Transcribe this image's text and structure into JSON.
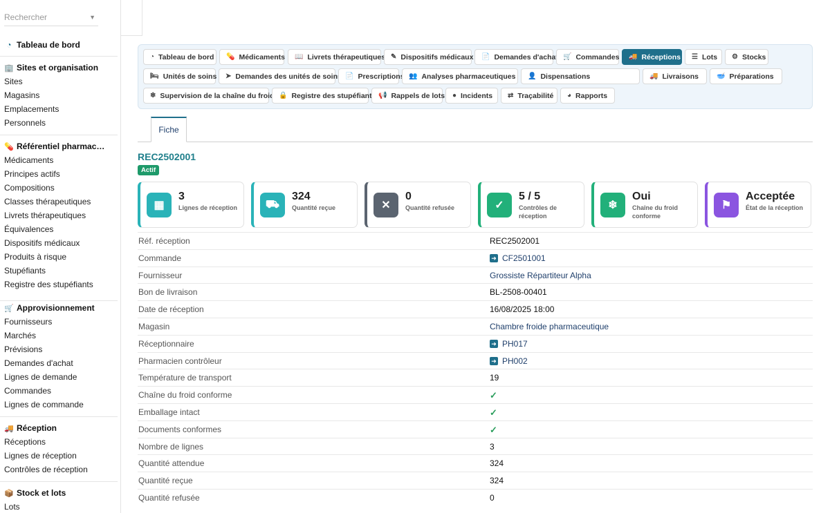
{
  "sidebar": {
    "search_placeholder": "Rechercher",
    "dashboard": "Tableau de bord",
    "sections": [
      {
        "title": "Sites et organisation",
        "items": [
          "Sites",
          "Magasins",
          "Emplacements",
          "Personnels"
        ]
      },
      {
        "title": "Référentiel pharmac…",
        "items": [
          "Médicaments",
          "Principes actifs",
          "Compositions",
          "Classes thérapeutiques",
          "Livrets thérapeutiques",
          "Équivalences",
          "Dispositifs médicaux",
          "Produits à risque",
          "Stupéfiants",
          "Registre des stupéfiants"
        ]
      },
      {
        "title": "Approvisionnement",
        "items": [
          "Fournisseurs",
          "Marchés",
          "Prévisions",
          "Demandes d'achat",
          "Lignes de demande",
          "Commandes",
          "Lignes de commande"
        ]
      },
      {
        "title": "Réception",
        "items": [
          "Réceptions",
          "Lignes de réception",
          "Contrôles de réception"
        ]
      },
      {
        "title": "Stock et lots",
        "items": [
          "Lots"
        ]
      }
    ]
  },
  "nav": {
    "row1": [
      "Tableau de bord",
      "Médicaments",
      "Livrets thérapeutiques",
      "Dispositifs médicaux",
      "Demandes d'achat",
      "Commandes",
      "Réceptions",
      "Lots",
      "Stocks"
    ],
    "row2": [
      "Unités de soins",
      "Demandes des unités de soins",
      "Prescriptions",
      "Analyses pharmaceutiques",
      "Dispensations",
      "Livraisons",
      "Préparations"
    ],
    "row3": [
      "Supervision de la chaîne du froid",
      "Registre des stupéfiants",
      "Rappels de lots",
      "Incidents",
      "Traçabilité",
      "Rapports"
    ],
    "active": "Réceptions"
  },
  "tab": "Fiche",
  "record": {
    "title": "REC2502001",
    "status": "Actif"
  },
  "cards": [
    {
      "value": "3",
      "label": "Lignes de réception",
      "color": "#2ab3b8"
    },
    {
      "value": "324",
      "label": "Quantité reçue",
      "color": "#2ab3b8"
    },
    {
      "value": "0",
      "label": "Quantité refusée",
      "color": "#5b6470"
    },
    {
      "value": "5 / 5",
      "label": "Contrôles de réception",
      "color": "#22b07a"
    },
    {
      "value": "Oui",
      "label": "Chaîne du froid conforme",
      "color": "#22b07a"
    },
    {
      "value": "Acceptée",
      "label": "État de la réception",
      "color": "#8b55e0"
    }
  ],
  "fields": [
    {
      "label": "Réf. réception",
      "value": "REC2502001"
    },
    {
      "label": "Commande",
      "value": "CF2501001",
      "link": true,
      "icon": true
    },
    {
      "label": "Fournisseur",
      "value": "Grossiste Répartiteur Alpha",
      "link": true
    },
    {
      "label": "Bon de livraison",
      "value": "BL-2508-00401"
    },
    {
      "label": "Date de réception",
      "value": "16/08/2025 18:00"
    },
    {
      "label": "Magasin",
      "value": "Chambre froide pharmaceutique",
      "link": true
    },
    {
      "label": "Réceptionnaire",
      "value": "PH017",
      "link": true,
      "icon": true
    },
    {
      "label": "Pharmacien contrôleur",
      "value": "PH002",
      "link": true,
      "icon": true
    },
    {
      "label": "Température de transport",
      "value": "19"
    },
    {
      "label": "Chaîne du froid conforme",
      "check": true
    },
    {
      "label": "Emballage intact",
      "check": true
    },
    {
      "label": "Documents conformes",
      "check": true
    },
    {
      "label": "Nombre de lignes",
      "value": "3"
    },
    {
      "label": "Quantité attendue",
      "value": "324"
    },
    {
      "label": "Quantité reçue",
      "value": "324"
    },
    {
      "label": "Quantité refusée",
      "value": "0"
    }
  ]
}
